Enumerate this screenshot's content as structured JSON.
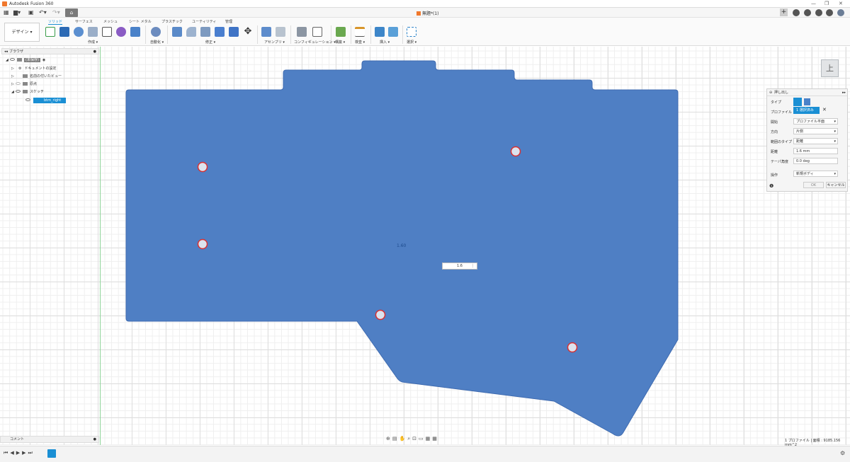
{
  "titlebar": {
    "app_title": "Autodesk Fusion 360",
    "min": "—",
    "restore": "❐",
    "close": "✕"
  },
  "quickaccess": {
    "doc_title": "無題*(1)"
  },
  "ribbon": {
    "workspace": "デザイン ▾",
    "tabs": [
      "ソリッド",
      "サーフェス",
      "メッシュ",
      "シート メタル",
      "プラスチック",
      "ユーティリティ",
      "管理"
    ],
    "groups": [
      "作成 ▾",
      "自動化 ▾",
      "修正 ▾",
      "アセンブリ ▾",
      "コンフィギュレーション ▾",
      "構築 ▾",
      "検査 ▾",
      "挿入 ▾",
      "選択 ▾"
    ]
  },
  "browser": {
    "header": "ブラウザ",
    "items": [
      {
        "label": "(未保存)"
      },
      {
        "label": "ドキュメントの設定"
      },
      {
        "label": "名前の付いたビュー"
      },
      {
        "label": "原点"
      },
      {
        "label": "スケッチ"
      },
      {
        "label": "btm_right"
      }
    ]
  },
  "viewcube": {
    "label": "上"
  },
  "extrude": {
    "title": "押し出し",
    "rows": [
      {
        "label": "タイプ",
        "value": ""
      },
      {
        "label": "プロファイル",
        "value": "1 選択済み"
      },
      {
        "label": "開始",
        "value": "プロファイル平面"
      },
      {
        "label": "方向",
        "value": "片側"
      },
      {
        "label": "範囲のタイプ",
        "value": "距離"
      },
      {
        "label": "距離",
        "value": "1.6 mm"
      },
      {
        "label": "テーパ角度",
        "value": "0.0 deg"
      },
      {
        "label": "操作",
        "value": "新規ボディ"
      }
    ],
    "ok": "OK",
    "cancel": "キャンセル"
  },
  "dimension": {
    "input": "1.6",
    "label": "1.60"
  },
  "comments": {
    "label": "コメント"
  },
  "status": {
    "text": "1 プロファイル | 面積 : 9185.156 mm^2"
  },
  "colors": {
    "profile": "#4f7fc4",
    "hole": "#d93030",
    "accent": "#1a8fd4"
  }
}
